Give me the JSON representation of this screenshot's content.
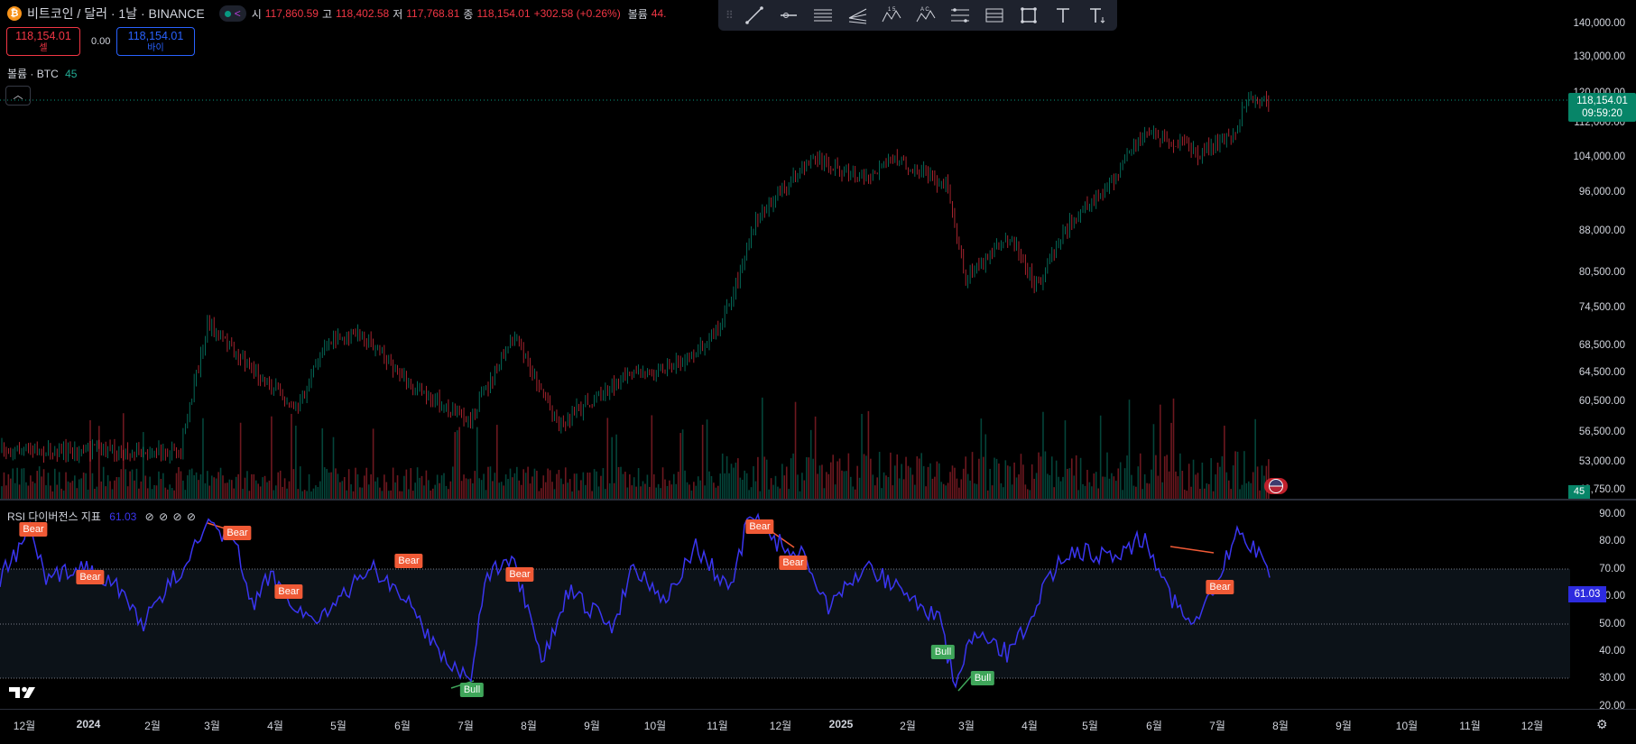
{
  "header": {
    "symbol_title": "비트코인 / 달러 · 1날 · BINANCE",
    "ohlc": [
      {
        "key": "시",
        "value": "117,860.59"
      },
      {
        "key": "고",
        "value": "118,402.58"
      },
      {
        "key": "저",
        "value": "117,768.81"
      },
      {
        "key": "종",
        "value": "118,154.01"
      }
    ],
    "change": "+302.58 (+0.26%)",
    "volume_label": "볼륨",
    "volume_value": "44."
  },
  "trade": {
    "sell_price": "118,154.01",
    "sell_label": "셀",
    "spread": "0.00",
    "buy_price": "118,154.01",
    "buy_label": "바이"
  },
  "volume_legend": {
    "label": "볼륨 · BTC",
    "value": "45"
  },
  "rsi_legend": {
    "title": "RSI 다이버전스 지표",
    "value": "61.03",
    "extra_icons": [
      "⊘",
      "⊘",
      "⊘",
      "⊘"
    ]
  },
  "price_axis": {
    "ticks": [
      "140,000.00",
      "130,000.00",
      "120,000.00",
      "112,000.00",
      "104,000.00",
      "96,000.00",
      "88,000.00",
      "80,500.00",
      "74,500.00",
      "68,500.00",
      "64,500.00",
      "60,500.00",
      "56,500.00",
      "53,000.00",
      "49,750.00"
    ],
    "last_price": "118,154.01",
    "countdown": "09:59:20",
    "volume_flag": "45"
  },
  "rsi_axis": {
    "ticks": [
      "90.00",
      "80.00",
      "70.00",
      "60.00",
      "50.00",
      "40.00",
      "30.00",
      "20.00"
    ],
    "current": "61.03"
  },
  "time_axis": {
    "ticks": [
      {
        "label": "12월",
        "bold": false
      },
      {
        "label": "2024",
        "bold": true
      },
      {
        "label": "2월",
        "bold": false
      },
      {
        "label": "3월",
        "bold": false
      },
      {
        "label": "4월",
        "bold": false
      },
      {
        "label": "5월",
        "bold": false
      },
      {
        "label": "6월",
        "bold": false
      },
      {
        "label": "7월",
        "bold": false
      },
      {
        "label": "8월",
        "bold": false
      },
      {
        "label": "9월",
        "bold": false
      },
      {
        "label": "10월",
        "bold": false
      },
      {
        "label": "11월",
        "bold": false
      },
      {
        "label": "12월",
        "bold": false
      },
      {
        "label": "2025",
        "bold": true
      },
      {
        "label": "2월",
        "bold": false
      },
      {
        "label": "3월",
        "bold": false
      },
      {
        "label": "4월",
        "bold": false
      },
      {
        "label": "5월",
        "bold": false
      },
      {
        "label": "6월",
        "bold": false
      },
      {
        "label": "7월",
        "bold": false
      },
      {
        "label": "8월",
        "bold": false
      },
      {
        "label": "9월",
        "bold": false
      },
      {
        "label": "10월",
        "bold": false
      },
      {
        "label": "11월",
        "bold": false
      },
      {
        "label": "12월",
        "bold": false
      }
    ]
  },
  "divergence_labels": [
    {
      "text": "Bear",
      "kind": "bear"
    },
    {
      "text": "Bear",
      "kind": "bear"
    },
    {
      "text": "Bear",
      "kind": "bear"
    },
    {
      "text": "Bear",
      "kind": "bear"
    },
    {
      "text": "Bear",
      "kind": "bear"
    },
    {
      "text": "Bull",
      "kind": "bull"
    },
    {
      "text": "Bear",
      "kind": "bear"
    },
    {
      "text": "Bear",
      "kind": "bear"
    },
    {
      "text": "Bear",
      "kind": "bear"
    },
    {
      "text": "Bull",
      "kind": "bull"
    },
    {
      "text": "Bull",
      "kind": "bull"
    },
    {
      "text": "Bear",
      "kind": "bear"
    }
  ],
  "toolbar": {
    "tools": [
      "trend-line-icon",
      "horizontal-ray-icon",
      "parallel-channel-icon",
      "pitchfork-icon",
      "xabcd-pattern-icon",
      "abcd-pattern-icon",
      "fib-retracement-icon",
      "gann-box-icon",
      "rectangle-icon",
      "text-icon",
      "anchored-text-icon"
    ]
  },
  "colors": {
    "up": "#089981",
    "down": "#f23645",
    "rsi_line": "#3a35f0",
    "accent_price": "#078568",
    "rsi_flag": "#2d2bdf"
  }
}
